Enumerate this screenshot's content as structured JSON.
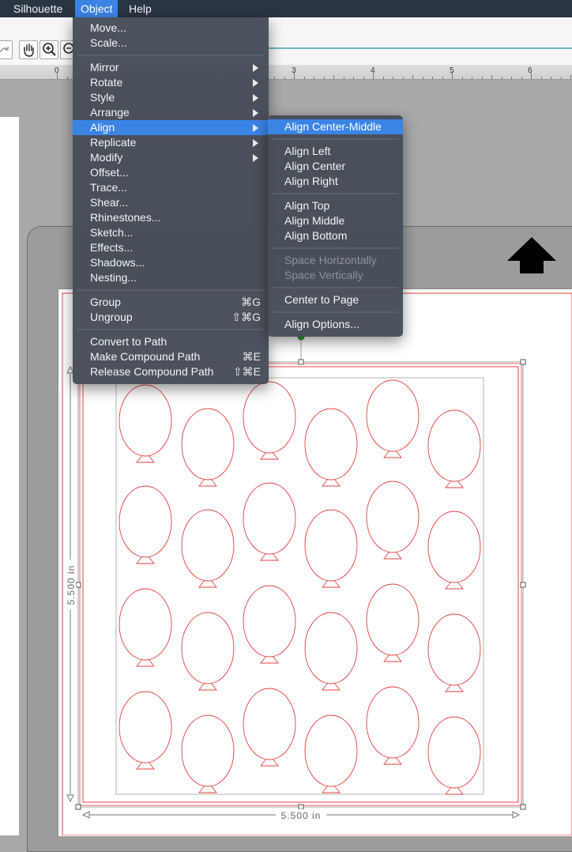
{
  "menubar": {
    "items": [
      {
        "label": "Silhouette"
      },
      {
        "label": "Object"
      },
      {
        "label": "Help"
      }
    ]
  },
  "ruler": {
    "labels": [
      "0",
      "3",
      "4",
      "5",
      "6"
    ]
  },
  "object_menu": {
    "groups": [
      [
        {
          "label": "Move..."
        },
        {
          "label": "Scale..."
        }
      ],
      [
        {
          "label": "Mirror",
          "submenu": true
        },
        {
          "label": "Rotate",
          "submenu": true
        },
        {
          "label": "Style",
          "submenu": true
        },
        {
          "label": "Arrange",
          "submenu": true
        },
        {
          "label": "Align",
          "submenu": true,
          "highlighted": true
        },
        {
          "label": "Replicate",
          "submenu": true
        },
        {
          "label": "Modify",
          "submenu": true
        },
        {
          "label": "Offset..."
        },
        {
          "label": "Trace..."
        },
        {
          "label": "Shear..."
        },
        {
          "label": "Rhinestones..."
        },
        {
          "label": "Sketch..."
        },
        {
          "label": "Effects..."
        },
        {
          "label": "Shadows..."
        },
        {
          "label": "Nesting..."
        }
      ],
      [
        {
          "label": "Group",
          "shortcut": "⌘G"
        },
        {
          "label": "Ungroup",
          "shortcut": "⇧⌘G"
        }
      ],
      [
        {
          "label": "Convert to Path"
        },
        {
          "label": "Make Compound Path",
          "shortcut": "⌘E"
        },
        {
          "label": "Release Compound Path",
          "shortcut": "⇧⌘E"
        }
      ]
    ]
  },
  "align_menu": {
    "groups": [
      [
        {
          "label": "Align Center-Middle",
          "highlighted": true
        }
      ],
      [
        {
          "label": "Align Left"
        },
        {
          "label": "Align Center"
        },
        {
          "label": "Align Right"
        }
      ],
      [
        {
          "label": "Align Top"
        },
        {
          "label": "Align Middle"
        },
        {
          "label": "Align Bottom"
        }
      ],
      [
        {
          "label": "Space Horizontally",
          "disabled": true
        },
        {
          "label": "Space Vertically",
          "disabled": true
        }
      ],
      [
        {
          "label": "Center to Page"
        }
      ],
      [
        {
          "label": "Align Options..."
        }
      ]
    ]
  },
  "selection": {
    "width_label": "5.500 in",
    "height_label": "5.500 in"
  },
  "balloons": {
    "rows": 4,
    "cols": 6,
    "count": 24
  },
  "colors": {
    "menubar_bg": "#2a3542",
    "menu_bg": "#464c56",
    "highlight": "#3a84e6",
    "cut_line": "#e8423f",
    "selection_handle": "#2fa52f"
  }
}
